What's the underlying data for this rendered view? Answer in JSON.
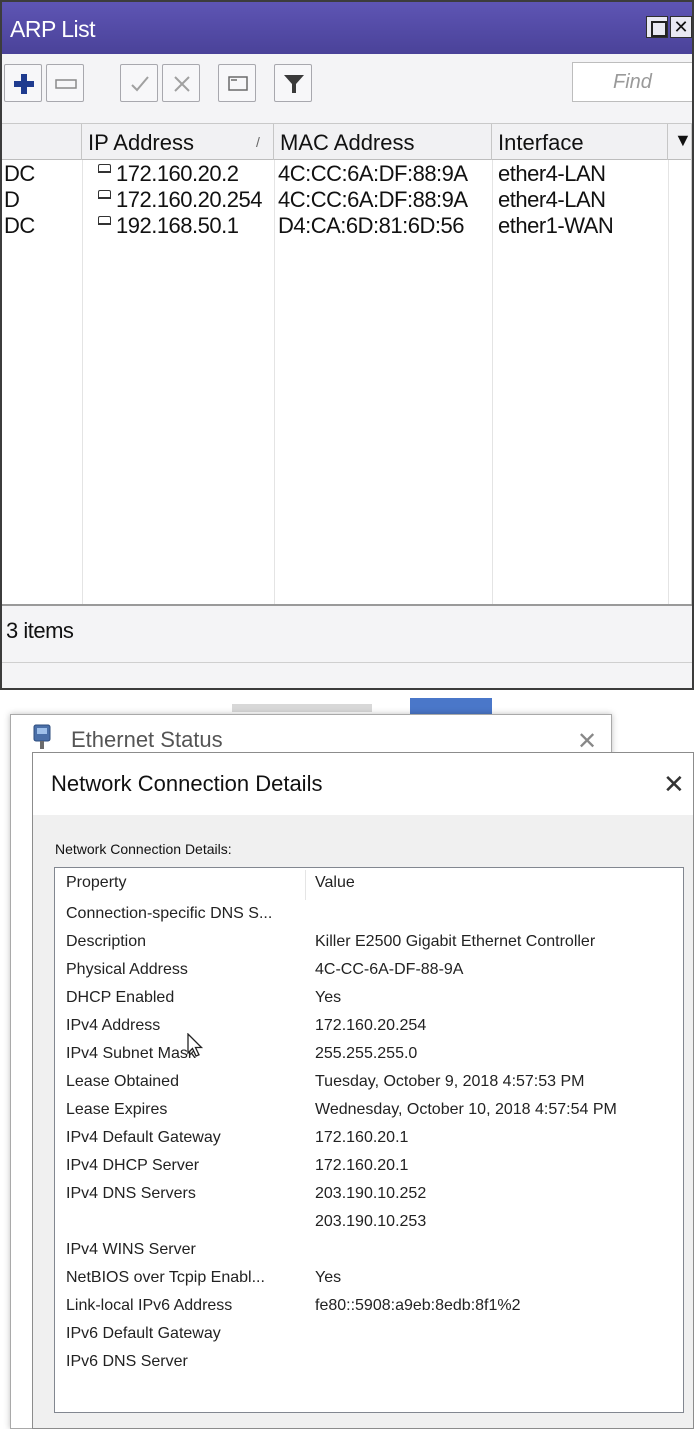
{
  "arp_window": {
    "title": "ARP List",
    "find_placeholder": "Find",
    "columns": [
      "IP Address",
      "MAC Address",
      "Interface"
    ],
    "sort_indicator": "/",
    "rows": [
      {
        "flags": "DC",
        "ip": "172.160.20.2",
        "mac": "4C:CC:6A:DF:88:9A",
        "interface": "ether4-LAN"
      },
      {
        "flags": "D",
        "ip": "172.160.20.254",
        "mac": "4C:CC:6A:DF:88:9A",
        "interface": "ether4-LAN"
      },
      {
        "flags": "DC",
        "ip": "192.168.50.1",
        "mac": "D4:CA:6D:81:6D:56",
        "interface": "ether1-WAN"
      }
    ],
    "status": "3 items",
    "toolbar_icons": [
      "add-icon",
      "remove-icon",
      "enable-icon",
      "disable-icon",
      "comment-icon",
      "filter-icon"
    ],
    "accent": "#4f47a3"
  },
  "ethernet_status": {
    "title": "Ethernet Status"
  },
  "details_dialog": {
    "title": "Network Connection Details",
    "label": "Network Connection Details:",
    "header_property": "Property",
    "header_value": "Value",
    "properties": [
      {
        "property": "Connection-specific DNS S...",
        "value": ""
      },
      {
        "property": "Description",
        "value": "Killer E2500 Gigabit Ethernet Controller"
      },
      {
        "property": "Physical Address",
        "value": "4C-CC-6A-DF-88-9A"
      },
      {
        "property": "DHCP Enabled",
        "value": "Yes"
      },
      {
        "property": "IPv4 Address",
        "value": "172.160.20.254"
      },
      {
        "property": "IPv4 Subnet Mask",
        "value": "255.255.255.0"
      },
      {
        "property": "Lease Obtained",
        "value": "Tuesday, October 9, 2018 4:57:53 PM"
      },
      {
        "property": "Lease Expires",
        "value": "Wednesday, October 10, 2018 4:57:54 PM"
      },
      {
        "property": "IPv4 Default Gateway",
        "value": "172.160.20.1"
      },
      {
        "property": "IPv4 DHCP Server",
        "value": "172.160.20.1"
      },
      {
        "property": "IPv4 DNS Servers",
        "value": "203.190.10.252"
      },
      {
        "property": "",
        "value": "203.190.10.253"
      },
      {
        "property": "IPv4 WINS Server",
        "value": ""
      },
      {
        "property": "NetBIOS over Tcpip Enabl...",
        "value": "Yes"
      },
      {
        "property": "Link-local IPv6 Address",
        "value": "fe80::5908:a9eb:8edb:8f1%2"
      },
      {
        "property": "IPv6 Default Gateway",
        "value": ""
      },
      {
        "property": "IPv6 DNS Server",
        "value": ""
      }
    ]
  }
}
